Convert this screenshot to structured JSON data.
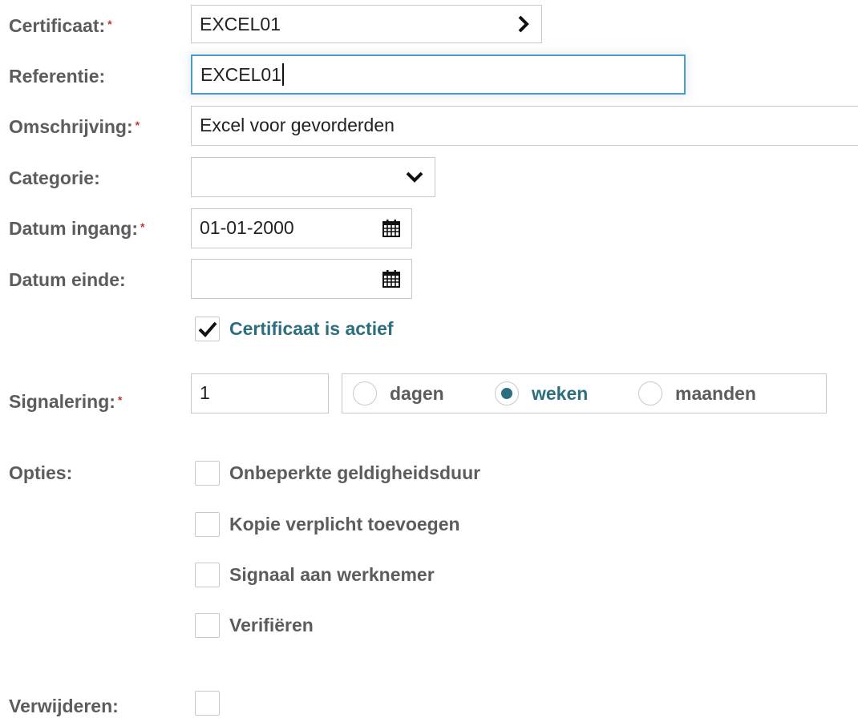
{
  "form": {
    "certificaat": {
      "label": "Certificaat:",
      "value": "EXCEL01",
      "required": "*"
    },
    "referentie": {
      "label": "Referentie:",
      "value": "EXCEL01"
    },
    "omschrijving": {
      "label": "Omschrijving:",
      "value": "Excel voor gevorderden",
      "required": "*"
    },
    "categorie": {
      "label": "Categorie:",
      "value": ""
    },
    "datum_ingang": {
      "label": "Datum ingang:",
      "value": "01-01-2000",
      "required": "*"
    },
    "datum_einde": {
      "label": "Datum einde:",
      "value": ""
    },
    "actief": {
      "label": "Certificaat is actief",
      "checked": true
    },
    "signalering": {
      "label": "Signalering:",
      "required": "*",
      "value": "1",
      "units": [
        {
          "label": "dagen",
          "selected": false
        },
        {
          "label": "weken",
          "selected": true
        },
        {
          "label": "maanden",
          "selected": false
        }
      ]
    },
    "opties": {
      "label": "Opties:",
      "items": [
        {
          "label": "Onbeperkte geldigheidsduur",
          "checked": false
        },
        {
          "label": "Kopie verplicht toevoegen",
          "checked": false
        },
        {
          "label": "Signaal aan werknemer",
          "checked": false
        },
        {
          "label": "Verifiëren",
          "checked": false
        }
      ]
    },
    "verwijderen": {
      "label": "Verwijderen:",
      "checked": false
    }
  },
  "colors": {
    "accent": "#2b6f7f",
    "required": "#c0392b",
    "label": "#5c5c5c",
    "border": "#c9c9c9",
    "focus": "#4a9cc2"
  },
  "icons": {
    "lookup": "chevron-right-icon",
    "dropdown": "chevron-down-icon",
    "date": "calendar-icon",
    "check": "checkmark-icon"
  }
}
